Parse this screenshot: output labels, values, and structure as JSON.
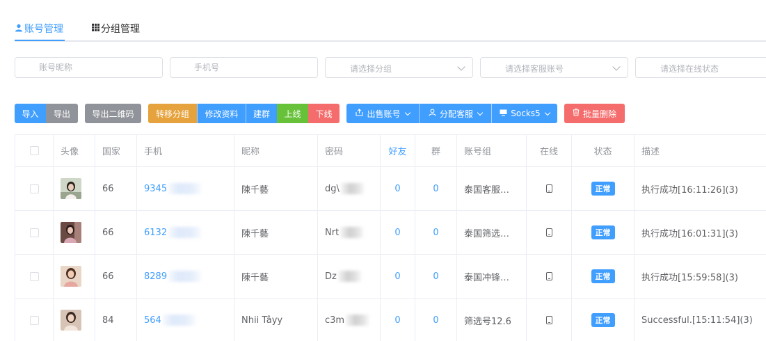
{
  "tabs": [
    {
      "label": "账号管理",
      "icon": "user-icon"
    },
    {
      "label": "分组管理",
      "icon": "grid-icon"
    }
  ],
  "filters": {
    "nickname_placeholder": "账号昵称",
    "phone_placeholder": "手机号",
    "group_placeholder": "请选择分组",
    "service_placeholder": "请选择客服账号",
    "online_placeholder": "请选择在线状态"
  },
  "toolbar": {
    "import": "导入",
    "export": "导出",
    "export_qr": "导出二维码",
    "move_group": "转移分组",
    "edit_profile": "修改资料",
    "create_group": "建群",
    "online": "上线",
    "offline": "下线",
    "sell_account": "出售账号",
    "assign_service": "分配客服",
    "socks5": "Socks5",
    "batch_delete": "批量删除"
  },
  "columns": {
    "avatar": "头像",
    "country": "国家",
    "phone": "手机",
    "nickname": "昵称",
    "password": "密码",
    "friends": "好友",
    "groups": "群",
    "account_group": "账号组",
    "online": "在线",
    "status": "状态",
    "description": "描述"
  },
  "rows": [
    {
      "country": "66",
      "phone": "9345",
      "nickname": "陳千藝",
      "password": "dg\\",
      "friends": "0",
      "groups": "0",
      "account_group": "泰国客服…",
      "status": "正常",
      "description": "执行成功[16:11:26](3)"
    },
    {
      "country": "66",
      "phone": "6132",
      "nickname": "陳千藝",
      "password": "Nrt",
      "friends": "0",
      "groups": "0",
      "account_group": "泰国筛选…",
      "status": "正常",
      "description": "执行成功[16:01:31](3)"
    },
    {
      "country": "66",
      "phone": "8289",
      "nickname": "陳千藝",
      "password": "Dz",
      "friends": "0",
      "groups": "0",
      "account_group": "泰国冲锋…",
      "status": "正常",
      "description": "执行成功[15:59:58](3)"
    },
    {
      "country": "84",
      "phone": "564",
      "nickname": "Nhii Tâyy",
      "password": "c3m",
      "friends": "0",
      "groups": "0",
      "account_group": "筛选号12.6",
      "status": "正常",
      "description": "Successful.[15:11:54](3)"
    }
  ]
}
